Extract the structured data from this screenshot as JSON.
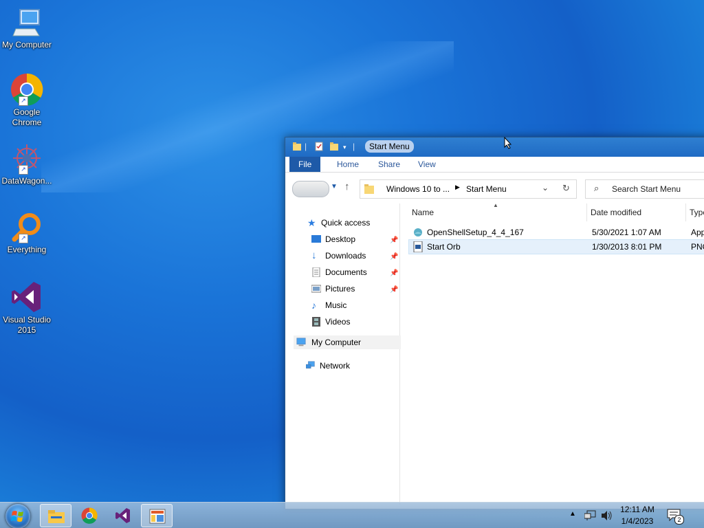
{
  "desktop": {
    "icons": [
      {
        "label": "My Computer",
        "icon": "computer-icon"
      },
      {
        "label": "Google Chrome",
        "icon": "chrome-icon"
      },
      {
        "label": "DataWagon...",
        "icon": "datawagon-icon"
      },
      {
        "label": "Everything",
        "icon": "everything-icon"
      },
      {
        "label": "Visual Studio 2015",
        "icon": "visual-studio-icon"
      }
    ]
  },
  "window": {
    "title": "Start Menu",
    "ribbon": {
      "file": "File",
      "home": "Home",
      "share": "Share",
      "view": "View"
    },
    "address": {
      "crumb1": "Windows 10 to ...",
      "crumb2": "Start Menu"
    },
    "search": {
      "placeholder": "Search Start Menu"
    },
    "nav": {
      "quick_access": "Quick access",
      "desktop": "Desktop",
      "downloads": "Downloads",
      "documents": "Documents",
      "pictures": "Pictures",
      "music": "Music",
      "videos": "Videos",
      "my_computer": "My Computer",
      "network": "Network"
    },
    "columns": {
      "name": "Name",
      "date_modified": "Date modified",
      "type": "Type"
    },
    "files": [
      {
        "name": "OpenShellSetup_4_4_167",
        "date": "5/30/2021 1:07 AM",
        "type": "App"
      },
      {
        "name": "Start Orb",
        "date": "1/30/2013 8:01 PM",
        "type": "PNG"
      }
    ]
  },
  "taskbar": {
    "time": "12:11 AM",
    "date": "1/4/2023",
    "notification_count": "2"
  },
  "colors": {
    "accent": "#1e5aa8",
    "titlebar": "#2474cb",
    "selection": "#e5f0fb"
  }
}
